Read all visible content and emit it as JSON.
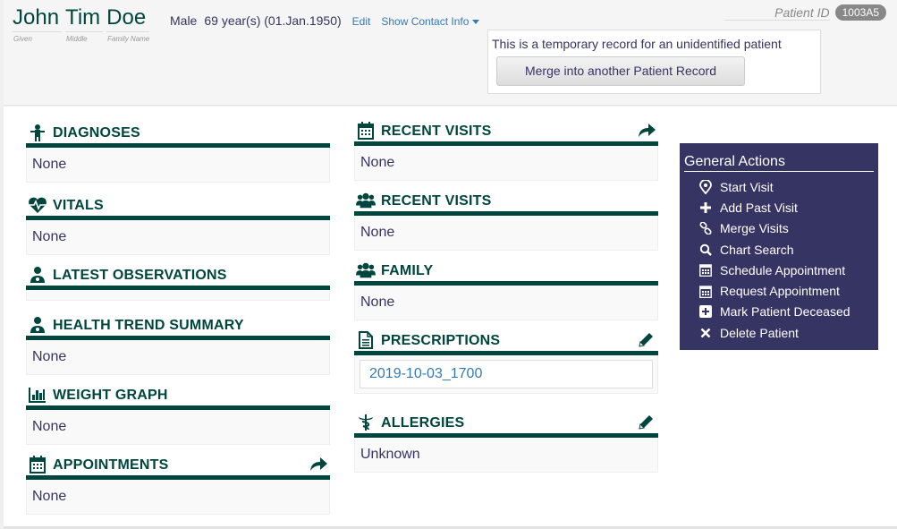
{
  "patient": {
    "given": "John",
    "middle": "Tim",
    "family": "Doe",
    "given_label": "Given",
    "middle_label": "Middle",
    "family_label": "Family Name",
    "gender": "Male",
    "age": "69 year(s) (01.Jan.1950)",
    "edit_label": "Edit",
    "contact_label": "Show Contact Info",
    "id_label": "Patient ID",
    "id_value": "1003A5"
  },
  "temporary": {
    "message": "This is a temporary record for an unidentified patient",
    "merge_button": "Merge into another Patient Record"
  },
  "left_panels": {
    "diagnoses": {
      "title": "DIAGNOSES",
      "body": "None"
    },
    "vitals": {
      "title": "VITALS",
      "body": "None"
    },
    "latest_obs": {
      "title": "LATEST OBSERVATIONS"
    },
    "health_trend": {
      "title": "HEALTH TREND SUMMARY",
      "body": "None"
    },
    "weight_graph": {
      "title": "WEIGHT GRAPH",
      "body": "None"
    },
    "appointments": {
      "title": "APPOINTMENTS",
      "body": "None"
    }
  },
  "middle_panels": {
    "recent_visits": {
      "title": "RECENT VISITS",
      "body": "None"
    },
    "recent_visits_2": {
      "title": "RECENT VISITS",
      "body": "None"
    },
    "family": {
      "title": "FAMILY",
      "body": "None"
    },
    "prescriptions": {
      "title": "PRESCRIPTIONS",
      "item": "2019-10-03_1700"
    },
    "allergies": {
      "title": "ALLERGIES",
      "body": "Unknown"
    }
  },
  "general_actions": {
    "title": "General Actions",
    "items": [
      {
        "label": "Start Visit",
        "icon": "map-marker-icon"
      },
      {
        "label": "Add Past Visit",
        "icon": "plus-icon"
      },
      {
        "label": "Merge Visits",
        "icon": "link-icon"
      },
      {
        "label": "Chart Search",
        "icon": "search-icon"
      },
      {
        "label": "Schedule Appointment",
        "icon": "calendar-icon"
      },
      {
        "label": "Request Appointment",
        "icon": "calendar-icon"
      },
      {
        "label": "Mark Patient Deceased",
        "icon": "plus-square-icon"
      },
      {
        "label": "Delete Patient",
        "icon": "x-icon"
      }
    ]
  },
  "colors": {
    "primary": "#00463f",
    "accent": "#363463",
    "link": "#337ab7"
  }
}
